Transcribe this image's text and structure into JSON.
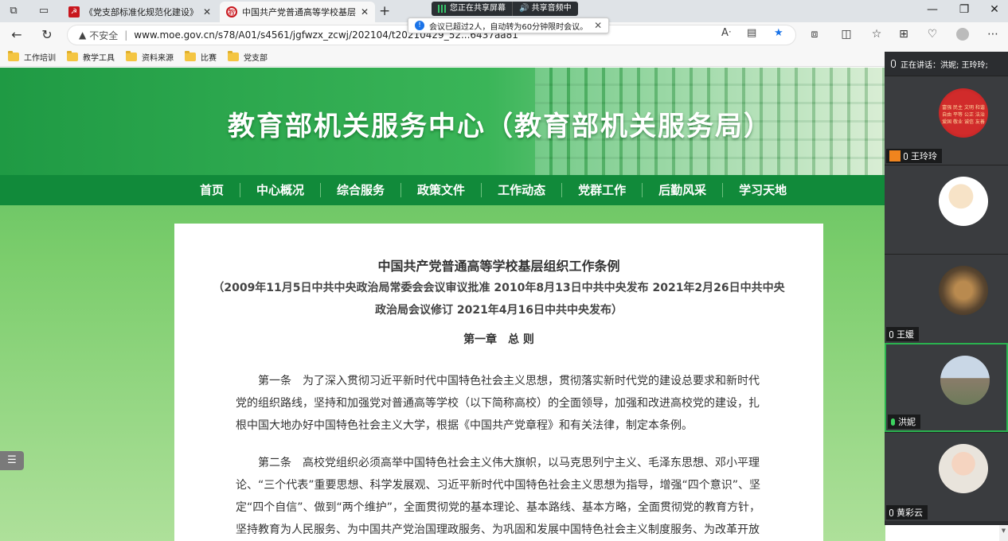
{
  "tabs": [
    {
      "title": "《党支部标准化规范化建设》系",
      "active": false,
      "favicon": "party-emblem-icon",
      "favicon_color": "#c8161d"
    },
    {
      "title": "中国共产党普通高等学校基层组",
      "active": true,
      "favicon": "moe-logo-icon",
      "favicon_color": "#c8161d"
    }
  ],
  "share_bar": {
    "sharing": "您正在共享屏幕",
    "audio": "共享音频中"
  },
  "toast": {
    "message": "会议已超过2人，自动转为60分钟限时会议。"
  },
  "address_bar": {
    "insecure_label": "不安全",
    "url": "www.moe.gov.cn/s78/A01/s4561/jgfwzx_zcwj/202104/t20210429_52...6437aa81"
  },
  "bookmarks": [
    "工作培训",
    "教学工具",
    "资料来源",
    "比赛",
    "党支部"
  ],
  "site": {
    "banner_title": "教育部机关服务中心（教育部机关服务局）",
    "nav": [
      "首页",
      "中心概况",
      "综合服务",
      "政策文件",
      "工作动态",
      "党群工作",
      "后勤风采",
      "学习天地"
    ]
  },
  "article": {
    "title": "中国共产党普通高等学校基层组织工作条例",
    "subtitle_line1": "（2009年11月5日中共中央政治局常委会会议审议批准 2010年8月13日中共中央发布 2021年2月26日中共中央",
    "subtitle_line2": "政治局会议修订 2021年4月16日中共中央发布）",
    "chapter": "第一章　总 则",
    "para1": "第一条　为了深入贯彻习近平新时代中国特色社会主义思想，贯彻落实新时代党的建设总要求和新时代党的组织路线，坚持和加强党对普通高等学校（以下简称高校）的全面领导，加强和改进高校党的建设，扎根中国大地办好中国特色社会主义大学，根据《中国共产党章程》和有关法律，制定本条例。",
    "para2": "第二条　高校党组织必须高举中国特色社会主义伟大旗帜，以马克思列宁主义、毛泽东思想、邓小平理论、“三个代表”重要思想、科学发展观、习近平新时代中国特色社会主义思想为指导，增强“四个意识”、坚定“四个自信”、做到“两个维护”，全面贯彻党的基本理论、基本路线、基本方略，全面贯彻党的教育方针，坚持教育为人民服务、为中国共产党治国理政服务、为巩固和发展中国特色社会主义制度服务、为改革开放和社会主义现代"
  },
  "meeting": {
    "speaking_label": "正在讲话：洪妮; 王玲玲;",
    "participants": [
      {
        "name": "",
        "avatar": "red-seal-avatar",
        "mic": "on"
      },
      {
        "name": "王玲玲",
        "avatar": "cartoon-avatar",
        "mic": "on",
        "host": true
      },
      {
        "name": "王媛",
        "avatar": "flower-photo-avatar",
        "mic": "off"
      },
      {
        "name": "洪妮",
        "avatar": "tree-photo-avatar",
        "mic": "speaking",
        "active": true
      },
      {
        "name": "黄彩云",
        "avatar": "child-photo-avatar",
        "mic": "off"
      }
    ]
  }
}
